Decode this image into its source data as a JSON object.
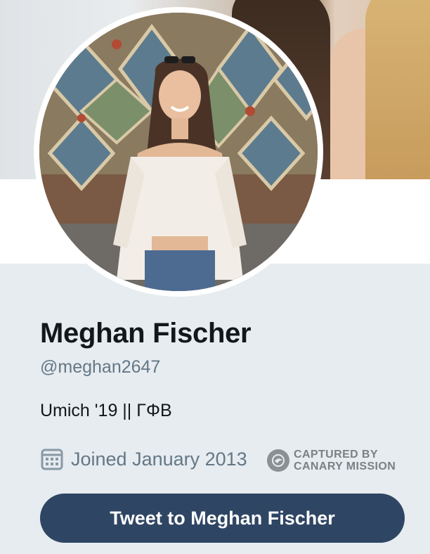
{
  "profile": {
    "name": "Meghan Fischer",
    "handle": "@meghan2647",
    "bio": "Umich '19 || ΓΦΒ",
    "joined": "Joined January 2013"
  },
  "watermark": {
    "line1": "CAPTURED BY",
    "line2": "CANARY MISSION"
  },
  "actions": {
    "tweet_to": "Tweet to Meghan Fischer"
  },
  "icons": {
    "calendar": "calendar-icon",
    "watermark": "canary-bird-icon"
  },
  "colors": {
    "background": "#e6ecf0",
    "button": "#2f4564",
    "secondary_text": "#657786",
    "primary_text": "#14171a"
  }
}
